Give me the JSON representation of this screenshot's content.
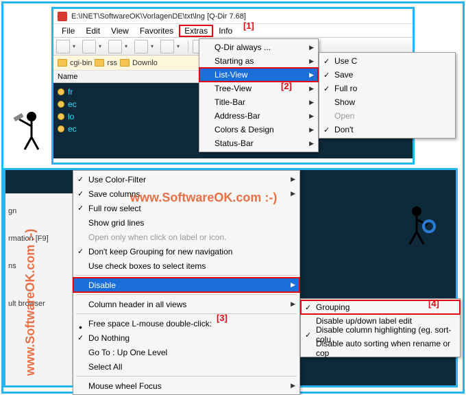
{
  "win1": {
    "title": "E:\\INET\\SoftwareOK\\VorlagenDE\\txt\\lng  [Q-Dir 7.68]",
    "menus": [
      "File",
      "Edit",
      "View",
      "Favorites",
      "Extras",
      "Info"
    ],
    "folders": [
      "cgi-bin",
      "rss",
      "Downlo"
    ],
    "list_header": "Name",
    "files": [
      "fr",
      "ec",
      "lo",
      "ec"
    ]
  },
  "extras_menu": [
    "Q-Dir always ...",
    "Starting as",
    "List-View",
    "Tree-View",
    "Title-Bar",
    "Address-Bar",
    "Colors & Design",
    "Status-Bar"
  ],
  "listview_sub": [
    {
      "t": "Use C",
      "c": true
    },
    {
      "t": "Save",
      "c": true
    },
    {
      "t": "Full ro",
      "c": true
    },
    {
      "t": "Show",
      "c": false
    },
    {
      "t": "Open",
      "c": false,
      "d": true
    },
    {
      "t": "Don't",
      "c": true
    }
  ],
  "big_menu": {
    "g1": [
      {
        "t": "Use Color-Filter",
        "c": true
      },
      {
        "t": "Save columns",
        "c": true
      },
      {
        "t": "Full row select",
        "c": true
      },
      {
        "t": "Show grid lines",
        "c": false
      },
      {
        "t": "Open only when click on label or icon.",
        "c": false,
        "d": true
      },
      {
        "t": "Don't keep Grouping for new navigation",
        "c": true
      },
      {
        "t": "Use check boxes to select items",
        "c": false
      }
    ],
    "disable": "Disable",
    "colhdr": "Column header in all views",
    "free": "Free space L-mouse double-click:",
    "g2": [
      {
        "t": "Do Nothing",
        "c": true
      },
      {
        "t": "Go To : Up One Level",
        "c": false
      },
      {
        "t": "Select All",
        "c": false
      }
    ],
    "wheel": "Mouse wheel Focus"
  },
  "disable_sub": [
    {
      "t": "Grouping",
      "c": true
    },
    {
      "t": "Disable up/down label edit",
      "c": false
    },
    {
      "t": "Disable column highlighting (eg. sort-colu",
      "c": true
    },
    {
      "t": "Disable auto sorting when rename or cop",
      "c": false
    }
  ],
  "sidebar_rows": [
    "gn",
    "rmation  [F9]",
    "ns",
    "ult browser"
  ],
  "annotations": {
    "a1": "[1]",
    "a2": "[2]",
    "a3": "[3]",
    "a4": "[4]"
  },
  "watermark": "www.SoftwareOK.com :-)"
}
